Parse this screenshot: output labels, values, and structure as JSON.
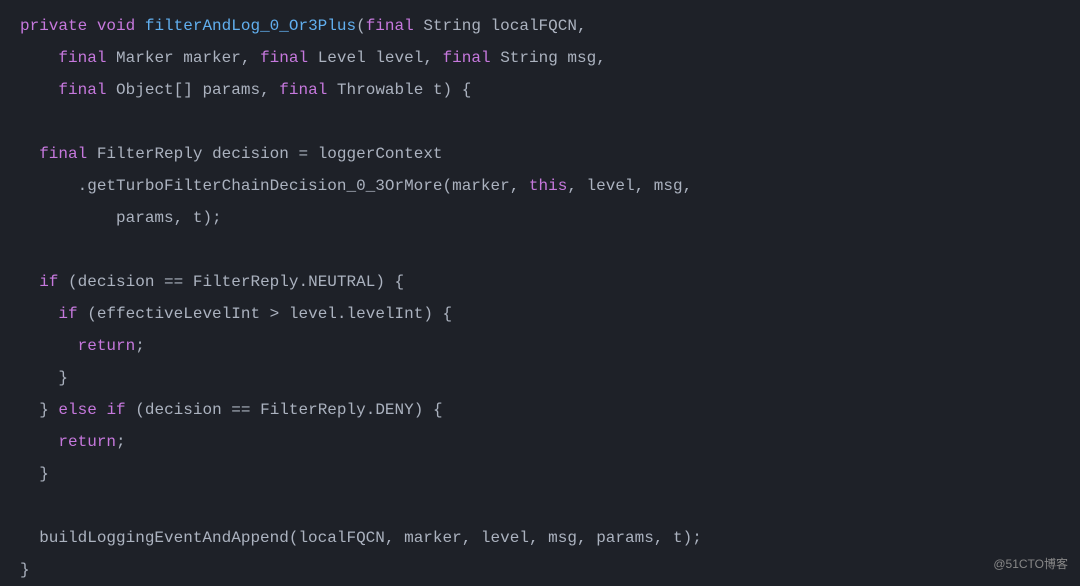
{
  "code": {
    "line1": {
      "k1": "private",
      "k2": "void",
      "method": "filterAndLog_0_Or3Plus",
      "p1": "(",
      "k3": "final",
      "type1": "String",
      "var1": "localFQCN",
      "comma": ","
    },
    "line2": {
      "k1": "final",
      "type1": "Marker",
      "var1": "marker",
      "c1": ",",
      "k2": "final",
      "type2": "Level",
      "var2": "level",
      "c2": ",",
      "k3": "final",
      "type3": "String",
      "var3": "msg",
      "c3": ","
    },
    "line3": {
      "k1": "final",
      "type1": "Object",
      "brackets": "[]",
      "var1": "params",
      "c1": ",",
      "k2": "final",
      "type2": "Throwable",
      "var2": "t",
      "close": ") {"
    },
    "line5": {
      "k1": "final",
      "type1": "FilterReply",
      "var1": "decision",
      "eq": "=",
      "var2": "loggerContext"
    },
    "line6": {
      "dot": ".",
      "method": "getTurboFilterChainDecision_0_3OrMore",
      "p1": "(",
      "var1": "marker",
      "c1": ",",
      "k1": "this",
      "c2": ",",
      "var2": "level",
      "c3": ",",
      "var3": "msg",
      "c4": ","
    },
    "line7": {
      "var1": "params",
      "c1": ",",
      "var2": "t",
      "close": ");"
    },
    "line9": {
      "k1": "if",
      "p1": "(",
      "var1": "decision",
      "eq": "==",
      "type1": "FilterReply",
      "dot": ".",
      "prop": "NEUTRAL",
      "close": ") {"
    },
    "line10": {
      "k1": "if",
      "p1": "(",
      "var1": "effectiveLevelInt",
      "gt": ">",
      "var2": "level",
      "dot": ".",
      "prop": "levelInt",
      "close": ") {"
    },
    "line11": {
      "k1": "return",
      "semi": ";"
    },
    "line12": {
      "brace": "}"
    },
    "line13": {
      "brace": "}",
      "k1": "else",
      "k2": "if",
      "p1": "(",
      "var1": "decision",
      "eq": "==",
      "type1": "FilterReply",
      "dot": ".",
      "prop": "DENY",
      "close": ") {"
    },
    "line14": {
      "k1": "return",
      "semi": ";"
    },
    "line15": {
      "brace": "}"
    },
    "line17": {
      "method": "buildLoggingEventAndAppend",
      "p1": "(",
      "var1": "localFQCN",
      "c1": ",",
      "var2": "marker",
      "c2": ",",
      "var3": "level",
      "c3": ",",
      "var4": "msg",
      "c4": ",",
      "var5": "params",
      "c5": ",",
      "var6": "t",
      "close": ");"
    },
    "line18": {
      "brace": "}"
    }
  },
  "watermark": "@51CTO博客"
}
